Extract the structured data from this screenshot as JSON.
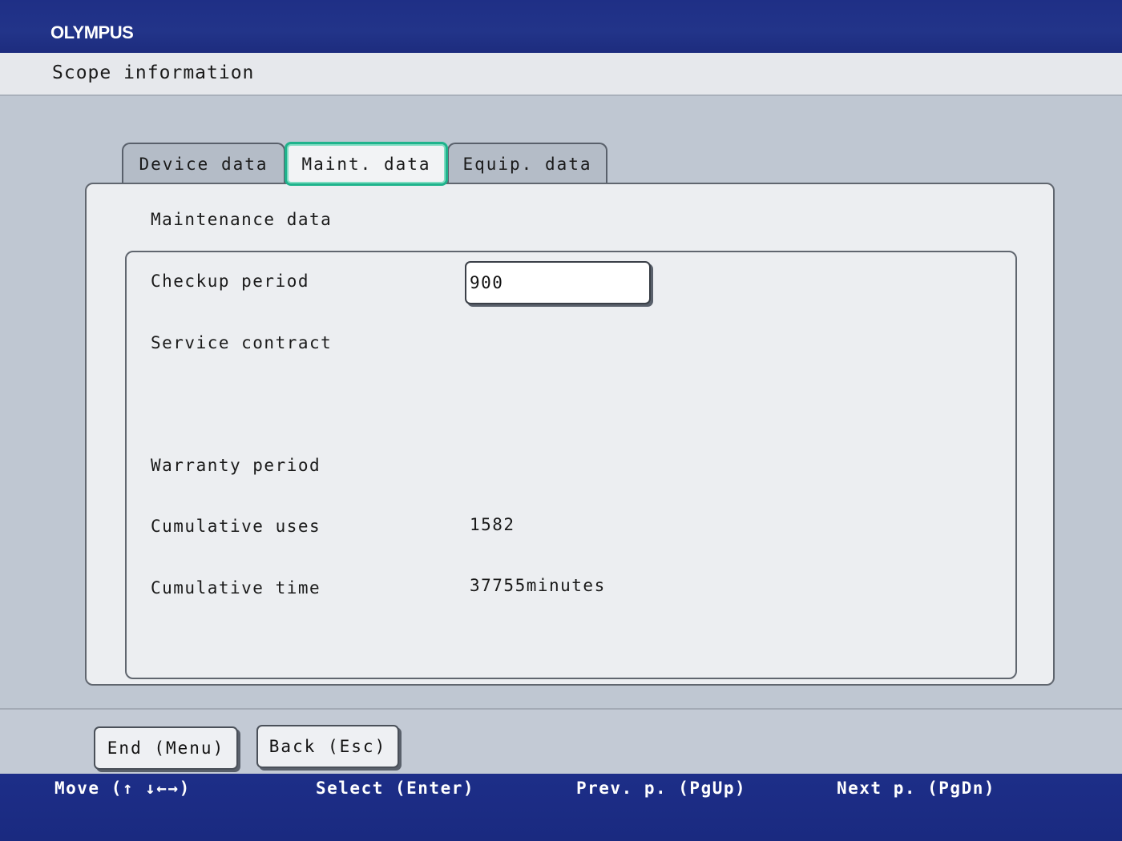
{
  "brand": {
    "logo": "OLYMPUS"
  },
  "window": {
    "title": "Scope information"
  },
  "tabs": [
    {
      "label": "Device data",
      "active": false
    },
    {
      "label": "Maint. data",
      "active": true
    },
    {
      "label": "Equip. data",
      "active": false
    }
  ],
  "panel": {
    "heading": "Maintenance data",
    "rows": {
      "checkup_period": {
        "label": "Checkup period",
        "value": "900"
      },
      "service_contract": {
        "label": "Service contract",
        "value": ""
      },
      "warranty_period": {
        "label": "Warranty period",
        "value": ""
      },
      "cumulative_uses": {
        "label": "Cumulative uses",
        "value": "1582"
      },
      "cumulative_time": {
        "label": "Cumulative time",
        "value": "37755minutes"
      }
    }
  },
  "buttons": {
    "end": "End (Menu)",
    "back": "Back (Esc)"
  },
  "footer": {
    "move": "Move (↑ ↓←→)",
    "select": "Select (Enter)",
    "prev": "Prev. p. (PgUp)",
    "next": "Next p. (PgDn)"
  },
  "colors": {
    "header_blue": "#1f2f86",
    "active_tab_border": "#1fb38c",
    "panel_bg": "#eceef1"
  }
}
